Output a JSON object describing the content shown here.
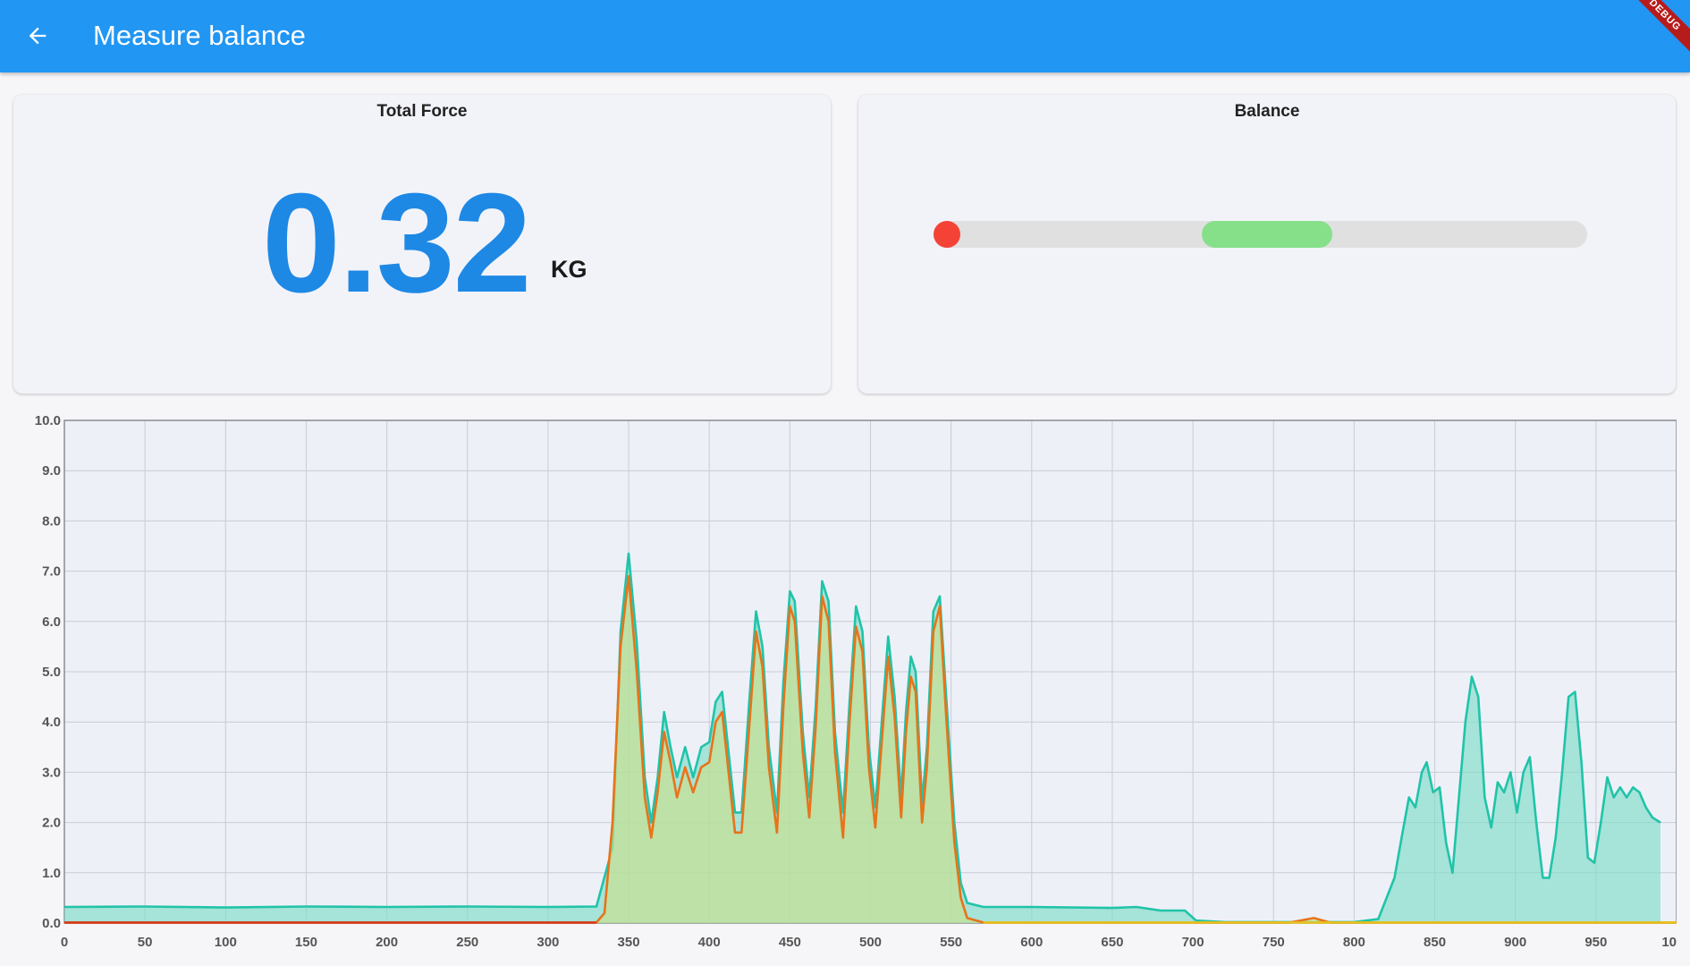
{
  "appbar": {
    "title": "Measure balance",
    "debug_banner": "DEBUG",
    "color": "#2196f3"
  },
  "force_card": {
    "title": "Total Force",
    "value": "0.32",
    "unit": "KG",
    "value_color": "#1e88e5"
  },
  "balance_card": {
    "title": "Balance",
    "indicator_position": 0,
    "target_zone": [
      0.41,
      0.61
    ],
    "track_color": "#e0e0e0",
    "zone_color": "#86e08a",
    "indicator_color": "#f44336"
  },
  "chart_data": {
    "type": "area",
    "xlim": [
      0,
      1000
    ],
    "ylim": [
      0,
      10
    ],
    "x_ticks": [
      "0",
      "50",
      "100",
      "150",
      "200",
      "250",
      "300",
      "350",
      "400",
      "450",
      "500",
      "550",
      "600",
      "650",
      "700",
      "750",
      "800",
      "850",
      "900",
      "950",
      "1000"
    ],
    "y_ticks": [
      "0.0",
      "1.0",
      "2.0",
      "3.0",
      "4.0",
      "5.0",
      "6.0",
      "7.0",
      "8.0",
      "9.0",
      "10.0"
    ],
    "grid": true,
    "series": [
      {
        "color": "#20c4a8",
        "fill": "#7fdcc8",
        "points": [
          [
            0,
            0.32
          ],
          [
            50,
            0.33
          ],
          [
            100,
            0.31
          ],
          [
            150,
            0.33
          ],
          [
            200,
            0.32
          ],
          [
            250,
            0.33
          ],
          [
            300,
            0.32
          ],
          [
            330,
            0.33
          ],
          [
            340,
            1.5
          ],
          [
            345,
            5.8
          ],
          [
            350,
            7.35
          ],
          [
            355,
            5.6
          ],
          [
            360,
            2.9
          ],
          [
            364,
            2.0
          ],
          [
            368,
            2.9
          ],
          [
            372,
            4.2
          ],
          [
            376,
            3.5
          ],
          [
            380,
            2.9
          ],
          [
            385,
            3.5
          ],
          [
            390,
            2.9
          ],
          [
            395,
            3.5
          ],
          [
            400,
            3.6
          ],
          [
            404,
            4.4
          ],
          [
            408,
            4.6
          ],
          [
            412,
            3.4
          ],
          [
            416,
            2.2
          ],
          [
            420,
            2.2
          ],
          [
            425,
            4.5
          ],
          [
            429,
            6.2
          ],
          [
            433,
            5.5
          ],
          [
            437,
            3.5
          ],
          [
            442,
            2.2
          ],
          [
            446,
            4.8
          ],
          [
            450,
            6.6
          ],
          [
            453,
            6.4
          ],
          [
            458,
            3.8
          ],
          [
            462,
            2.5
          ],
          [
            466,
            4.3
          ],
          [
            470,
            6.8
          ],
          [
            474,
            6.4
          ],
          [
            478,
            3.8
          ],
          [
            483,
            2.2
          ],
          [
            487,
            4.4
          ],
          [
            491,
            6.3
          ],
          [
            495,
            5.8
          ],
          [
            499,
            3.5
          ],
          [
            503,
            2.3
          ],
          [
            507,
            4.0
          ],
          [
            511,
            5.7
          ],
          [
            515,
            4.5
          ],
          [
            519,
            2.5
          ],
          [
            522,
            4.2
          ],
          [
            525,
            5.3
          ],
          [
            528,
            5.0
          ],
          [
            532,
            2.4
          ],
          [
            535,
            3.5
          ],
          [
            539,
            6.2
          ],
          [
            543,
            6.5
          ],
          [
            547,
            4.5
          ],
          [
            552,
            2.0
          ],
          [
            556,
            0.8
          ],
          [
            560,
            0.4
          ],
          [
            570,
            0.32
          ],
          [
            600,
            0.32
          ],
          [
            650,
            0.3
          ],
          [
            665,
            0.32
          ],
          [
            680,
            0.25
          ],
          [
            695,
            0.25
          ],
          [
            702,
            0.05
          ],
          [
            720,
            0.02
          ],
          [
            800,
            0.02
          ],
          [
            815,
            0.08
          ],
          [
            825,
            0.9
          ],
          [
            830,
            1.8
          ],
          [
            834,
            2.5
          ],
          [
            838,
            2.3
          ],
          [
            842,
            3.0
          ],
          [
            845,
            3.2
          ],
          [
            849,
            2.6
          ],
          [
            853,
            2.7
          ],
          [
            857,
            1.6
          ],
          [
            861,
            1.0
          ],
          [
            865,
            2.5
          ],
          [
            869,
            4.0
          ],
          [
            873,
            4.9
          ],
          [
            877,
            4.5
          ],
          [
            881,
            2.5
          ],
          [
            885,
            1.9
          ],
          [
            889,
            2.8
          ],
          [
            893,
            2.6
          ],
          [
            897,
            3.0
          ],
          [
            901,
            2.2
          ],
          [
            905,
            3.0
          ],
          [
            909,
            3.3
          ],
          [
            913,
            2.0
          ],
          [
            917,
            0.9
          ],
          [
            921,
            0.9
          ],
          [
            925,
            1.7
          ],
          [
            929,
            3.0
          ],
          [
            933,
            4.5
          ],
          [
            937,
            4.6
          ],
          [
            941,
            3.2
          ],
          [
            945,
            1.3
          ],
          [
            949,
            1.2
          ],
          [
            953,
            2.0
          ],
          [
            957,
            2.9
          ],
          [
            961,
            2.5
          ],
          [
            965,
            2.7
          ],
          [
            969,
            2.5
          ],
          [
            973,
            2.7
          ],
          [
            977,
            2.6
          ],
          [
            981,
            2.3
          ],
          [
            985,
            2.1
          ],
          [
            990,
            2.0
          ]
        ]
      },
      {
        "color": "#e8731a",
        "fill": "#c9e08a",
        "points": [
          [
            0,
            0.01
          ],
          [
            330,
            0.01
          ],
          [
            335,
            0.2
          ],
          [
            340,
            2.0
          ],
          [
            345,
            5.5
          ],
          [
            350,
            6.9
          ],
          [
            355,
            5.0
          ],
          [
            360,
            2.5
          ],
          [
            364,
            1.7
          ],
          [
            368,
            2.6
          ],
          [
            372,
            3.8
          ],
          [
            376,
            3.2
          ],
          [
            380,
            2.5
          ],
          [
            385,
            3.1
          ],
          [
            390,
            2.6
          ],
          [
            395,
            3.1
          ],
          [
            400,
            3.2
          ],
          [
            404,
            4.0
          ],
          [
            408,
            4.2
          ],
          [
            412,
            3.0
          ],
          [
            416,
            1.8
          ],
          [
            420,
            1.8
          ],
          [
            425,
            4.0
          ],
          [
            429,
            5.8
          ],
          [
            433,
            5.1
          ],
          [
            437,
            3.1
          ],
          [
            442,
            1.8
          ],
          [
            446,
            4.3
          ],
          [
            450,
            6.3
          ],
          [
            453,
            6.0
          ],
          [
            458,
            3.4
          ],
          [
            462,
            2.1
          ],
          [
            466,
            3.9
          ],
          [
            470,
            6.5
          ],
          [
            474,
            6.0
          ],
          [
            478,
            3.4
          ],
          [
            483,
            1.7
          ],
          [
            487,
            4.0
          ],
          [
            491,
            5.9
          ],
          [
            495,
            5.4
          ],
          [
            499,
            3.1
          ],
          [
            503,
            1.9
          ],
          [
            507,
            3.6
          ],
          [
            511,
            5.3
          ],
          [
            515,
            4.1
          ],
          [
            519,
            2.1
          ],
          [
            522,
            3.8
          ],
          [
            525,
            4.9
          ],
          [
            528,
            4.6
          ],
          [
            532,
            2.0
          ],
          [
            535,
            3.1
          ],
          [
            539,
            5.8
          ],
          [
            543,
            6.3
          ],
          [
            547,
            4.1
          ],
          [
            552,
            1.6
          ],
          [
            556,
            0.5
          ],
          [
            560,
            0.1
          ],
          [
            570,
            0.01
          ],
          [
            760,
            0.01
          ],
          [
            775,
            0.1
          ],
          [
            785,
            0.01
          ],
          [
            1000,
            0.01
          ]
        ]
      },
      {
        "color": "#d63b1c",
        "points": [
          [
            0,
            0.01
          ],
          [
            330,
            0.01
          ]
        ]
      },
      {
        "color": "#e4c21e",
        "points": [
          [
            570,
            0.01
          ],
          [
            1000,
            0.01
          ]
        ]
      }
    ]
  }
}
